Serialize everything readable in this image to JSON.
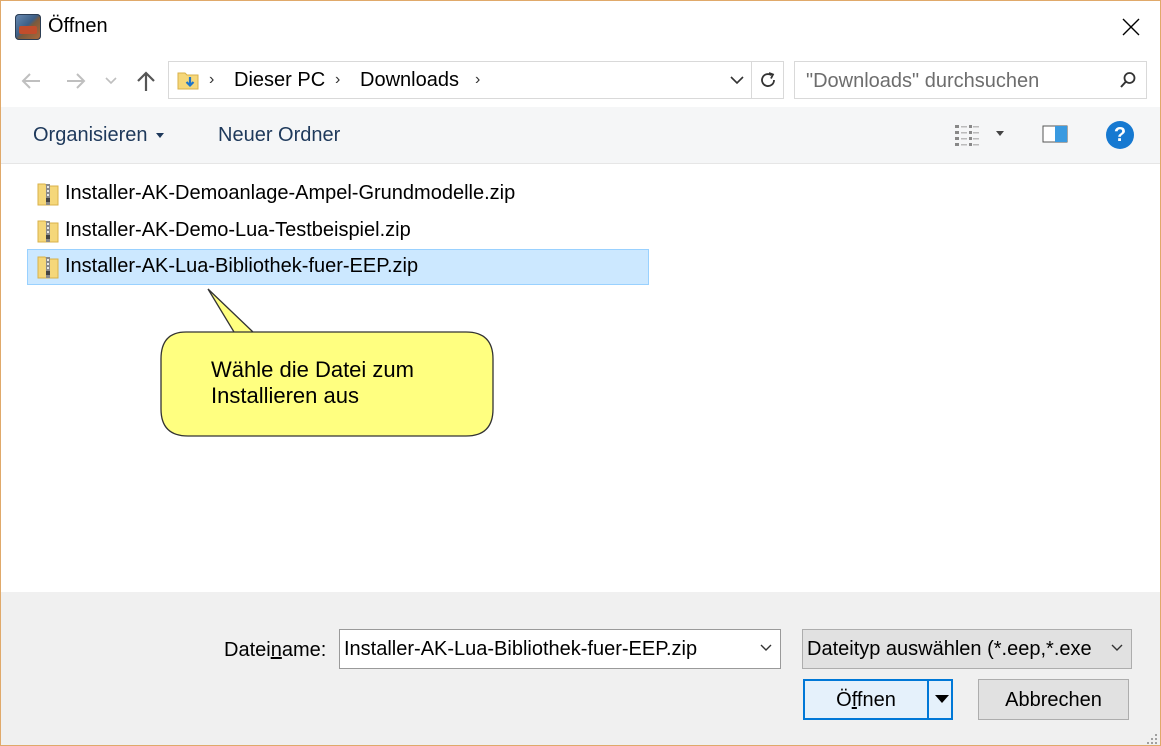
{
  "titlebar": {
    "title": "Öffnen",
    "close_icon": "close-icon"
  },
  "nav": {
    "back_icon": "arrow-left-icon",
    "forward_icon": "arrow-right-icon",
    "recent_icon": "chevron-down-icon",
    "up_icon": "arrow-up-icon",
    "breadcrumb": [
      "Dieser PC",
      "Downloads"
    ],
    "search_placeholder": "\"Downloads\" durchsuchen"
  },
  "toolbar": {
    "organize_label": "Organisieren",
    "new_folder_label": "Neuer Ordner"
  },
  "files": [
    {
      "name": "Installer-AK-Demoanlage-Ampel-Grundmodelle.zip",
      "selected": false
    },
    {
      "name": "Installer-AK-Demo-Lua-Testbeispiel.zip",
      "selected": false
    },
    {
      "name": "Installer-AK-Lua-Bibliothek-fuer-EEP.zip",
      "selected": true
    }
  ],
  "callout": {
    "line1": "Wähle die Datei zum",
    "line2": "Installieren aus",
    "color": "#ffff80"
  },
  "footer": {
    "filename_label_pre": "Datei",
    "filename_label_accel": "n",
    "filename_label_post": "ame:",
    "filename_value": "Installer-AK-Lua-Bibliothek-fuer-EEP.zip",
    "filetype_value": "Dateityp auswählen (*.eep,*.exe",
    "open_label_pre": "Ö",
    "open_label_accel": "f",
    "open_label_post": "fnen",
    "cancel_label": "Abbrechen"
  },
  "colors": {
    "accent": "#0078d7",
    "selection": "#cce8ff",
    "help": "#1679d1"
  }
}
